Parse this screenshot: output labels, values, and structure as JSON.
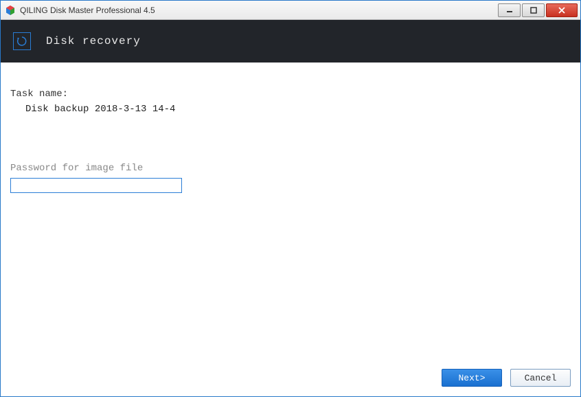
{
  "window": {
    "title": "QILING Disk Master Professional 4.5"
  },
  "header": {
    "title": "Disk recovery"
  },
  "content": {
    "task_name_label": "Task name:",
    "task_name_value": "Disk backup 2018-3-13 14-4",
    "password_label": "Password for image file",
    "password_value": ""
  },
  "footer": {
    "next_label": "Next>",
    "cancel_label": "Cancel"
  }
}
